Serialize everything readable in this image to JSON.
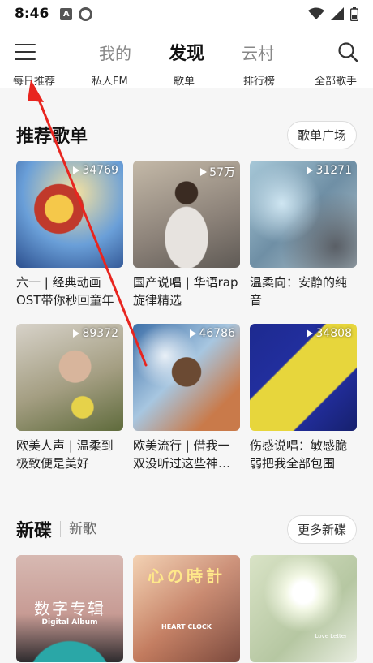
{
  "status": {
    "time": "8:46",
    "a_badge": "A"
  },
  "nav": {
    "tabs": [
      {
        "label": "我的"
      },
      {
        "label": "发现"
      },
      {
        "label": "云村"
      }
    ]
  },
  "quick": {
    "items": [
      "每日推荐",
      "私人FM",
      "歌单",
      "排行榜",
      "全部歌手"
    ]
  },
  "recommend": {
    "title": "推荐歌单",
    "more": "歌单广场",
    "playlists": [
      {
        "count": "34769",
        "title": "六一 | 经典动画OST带你秒回童年"
      },
      {
        "count": "57万",
        "title": "国产说唱 | 华语rap旋律精选"
      },
      {
        "count": "31271",
        "title": "温柔向：安静的纯音"
      },
      {
        "count": "89372",
        "title": "欧美人声 | 温柔到极致便是美好"
      },
      {
        "count": "46786",
        "title": "欧美流行 | 借我一双没听过这些神…"
      },
      {
        "count": "34808",
        "title": "伤感说唱：敏感脆弱把我全部包围"
      }
    ]
  },
  "new_disc": {
    "title": "新碟",
    "sub": "新歌",
    "more": "更多新碟",
    "albums": [
      {
        "main": "数字专辑",
        "sub": "Digital Album"
      },
      {
        "main": "心の時計",
        "sub": "HEART CLOCK"
      },
      {
        "main": "",
        "sub": "Love Letter"
      }
    ]
  },
  "colors": {
    "arrow": "#e8251f",
    "accent": "#111111"
  }
}
